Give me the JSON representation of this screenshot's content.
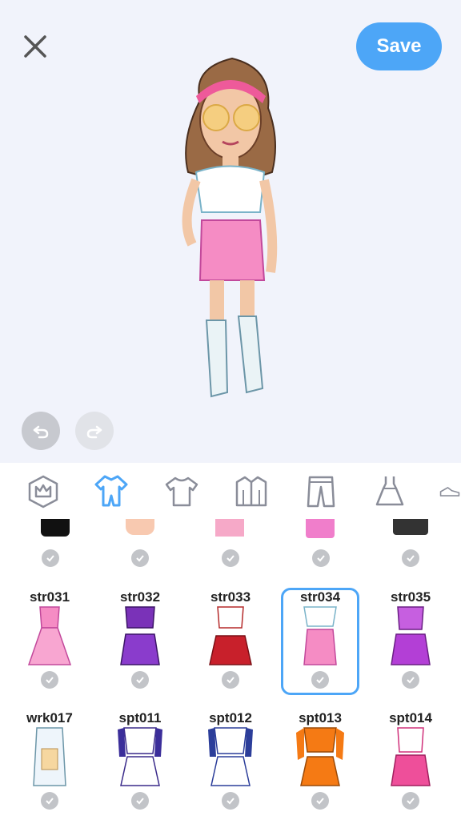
{
  "header": {
    "save_label": "Save",
    "close_icon": "close-icon"
  },
  "history": {
    "undo_icon": "undo-icon",
    "redo_icon": "redo-icon"
  },
  "category_tabs": [
    {
      "icon": "crown-badge-icon",
      "active": false
    },
    {
      "icon": "outfit-bodysuit-icon",
      "active": true
    },
    {
      "icon": "tshirt-icon",
      "active": false
    },
    {
      "icon": "jacket-icon",
      "active": false
    },
    {
      "icon": "pants-icon",
      "active": false
    },
    {
      "icon": "dress-icon",
      "active": false
    },
    {
      "icon": "shoe-icon",
      "active": false
    }
  ],
  "colors": {
    "accent": "#4da6f7",
    "check_gray": "#c2c4c8",
    "stage_bg": "#f1f3fb"
  },
  "outfits_row1": [
    {
      "code": "str031"
    },
    {
      "code": "str032"
    },
    {
      "code": "str033"
    },
    {
      "code": "str034",
      "selected": true
    },
    {
      "code": "str035"
    }
  ],
  "outfits_row2": [
    {
      "code": "wrk017"
    },
    {
      "code": "spt011"
    },
    {
      "code": "spt012"
    },
    {
      "code": "spt013"
    },
    {
      "code": "spt014"
    }
  ]
}
